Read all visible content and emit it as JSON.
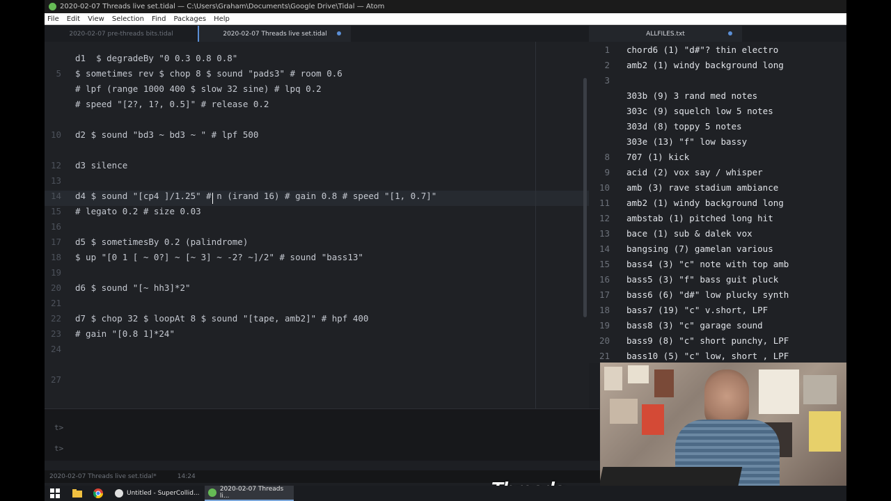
{
  "window": {
    "title": "2020-02-07 Threads live set.tidal — C:\\Users\\Graham\\Documents\\Google Drive\\Tidal — Atom"
  },
  "menu": [
    "File",
    "Edit",
    "View",
    "Selection",
    "Find",
    "Packages",
    "Help"
  ],
  "tabs_left": [
    {
      "label": "2020-02-07 pre-threads bits.tidal"
    },
    {
      "label": "2020-02-07 Threads live set.tidal",
      "modified": true
    }
  ],
  "tabs_right": [
    {
      "label": "ALLFILES.txt",
      "modified": true
    }
  ],
  "left_editor": {
    "lines": [
      {
        "num": "",
        "text": "d1  $ degradeBy \"0 0.3 0.8 0.8\""
      },
      {
        "num": "5",
        "text": "$ sometimes rev $ chop 8 $ sound \"pads3\" # room 0.6"
      },
      {
        "num": "",
        "text": "# lpf (range 1000 400 $ slow 32 sine) # lpq 0.2"
      },
      {
        "num": "",
        "text": "# speed \"[2?, 1?, 0.5]\" # release 0.2"
      },
      {
        "num": "",
        "text": ""
      },
      {
        "num": "10",
        "text": "d2 $ sound \"bd3 ~ bd3 ~ \" # lpf 500"
      },
      {
        "num": "",
        "text": ""
      },
      {
        "num": "12",
        "text": "d3 silence"
      },
      {
        "num": "13",
        "text": ""
      },
      {
        "num": "14",
        "text": "d4 $ sound \"[cp4 ]/1.25\" # n (irand 16) # gain 0.8 # speed \"[1, 0.7]\""
      },
      {
        "num": "15",
        "text": "# legato 0.2 # size 0.03"
      },
      {
        "num": "16",
        "text": ""
      },
      {
        "num": "17",
        "text": "d5 $ sometimesBy 0.2 (palindrome)"
      },
      {
        "num": "18",
        "text": "$ up \"[0 1 [ ~ 0?] ~ [~ 3] ~ -2? ~]/2\" # sound \"bass13\""
      },
      {
        "num": "19",
        "text": ""
      },
      {
        "num": "20",
        "text": "d6 $ sound \"[~ hh3]*2\""
      },
      {
        "num": "21",
        "text": ""
      },
      {
        "num": "22",
        "text": "d7 $ chop 32 $ loopAt 8 $ sound \"[tape, amb2]\" # hpf 400"
      },
      {
        "num": "23",
        "text": "# gain \"[0.8 1]*24\""
      },
      {
        "num": "24",
        "text": ""
      },
      {
        "num": "",
        "text": ""
      },
      {
        "num": "27",
        "text": ""
      }
    ]
  },
  "console": {
    "prompts": [
      "t>",
      "t>"
    ]
  },
  "status": {
    "file": "2020-02-07 Threads live set.tidal*",
    "position": "14:24"
  },
  "right_editor": {
    "lines": [
      {
        "num": "1",
        "text": "chord6 (1) \"d#\"? thin electro"
      },
      {
        "num": "2",
        "text": "amb2 (1) windy background long"
      },
      {
        "num": "3",
        "text": ""
      },
      {
        "num": "",
        "text": "303b (9) 3 rand med notes"
      },
      {
        "num": "",
        "text": "303c (9) squelch low 5 notes"
      },
      {
        "num": "",
        "text": "303d (8) toppy 5 notes"
      },
      {
        "num": "",
        "text": "303e (13) \"f\" low bassy"
      },
      {
        "num": "8",
        "text": "707 (1) kick"
      },
      {
        "num": "9",
        "text": "acid (2) vox say / whisper"
      },
      {
        "num": "10",
        "text": "amb (3) rave stadium ambiance"
      },
      {
        "num": "11",
        "text": "amb2 (1) windy background long"
      },
      {
        "num": "12",
        "text": "ambstab (1) pitched long hit"
      },
      {
        "num": "13",
        "text": "bace (1) sub & dalek vox"
      },
      {
        "num": "14",
        "text": "bangsing (7) gamelan various"
      },
      {
        "num": "15",
        "text": "bass4 (3) \"c\" note with top amb"
      },
      {
        "num": "16",
        "text": "bass5 (3) \"f\" bass guit pluck"
      },
      {
        "num": "17",
        "text": "bass6 (6) \"d#\" low plucky synth"
      },
      {
        "num": "18",
        "text": "bass7 (19) \"c\" v.short, LPF"
      },
      {
        "num": "19",
        "text": "bass8 (3) \"c\" garage sound"
      },
      {
        "num": "20",
        "text": "bass9 (8) \"c\" short punchy, LPF"
      },
      {
        "num": "21",
        "text": "bass10 (5) \"c\" low, short , LPF"
      }
    ]
  },
  "brand": {
    "logo_text": "Threads"
  },
  "taskbar": {
    "items": [
      {
        "label": "Untitled - SuperCollid..."
      },
      {
        "label": "2020-02-07 Threads li...",
        "active": true
      }
    ]
  },
  "colors": {
    "accent": "#5b8fd6",
    "editor_bg": "#1f2125",
    "string": "#98c379",
    "number": "#d19a66"
  }
}
